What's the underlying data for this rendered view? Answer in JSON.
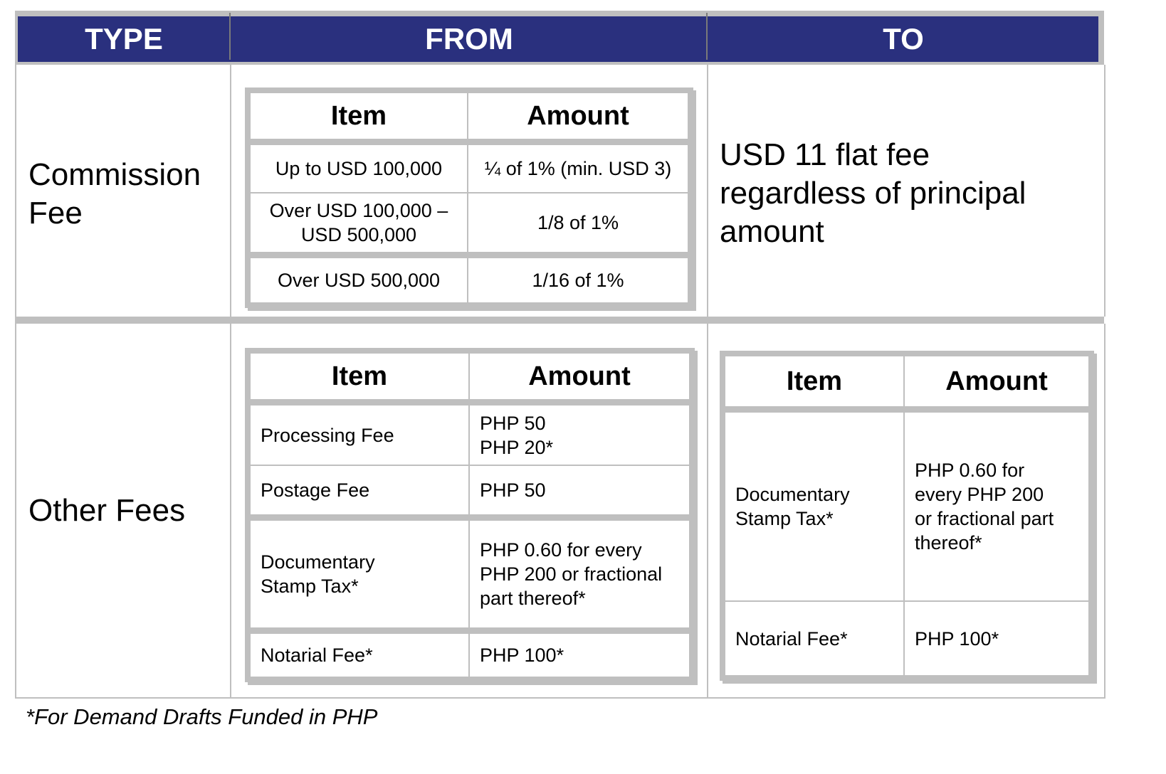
{
  "header": {
    "type": "TYPE",
    "from": "FROM",
    "to": "TO"
  },
  "commission": {
    "type_line1": "Commission",
    "type_line2": "Fee",
    "from_table": {
      "col_item": "Item",
      "col_amount": "Amount",
      "rows": [
        {
          "item": "Up to USD 100,000",
          "amount": "¼ of 1% (min. USD 3)"
        },
        {
          "item_line1": "Over USD 100,000 –",
          "item_line2": "USD 500,000",
          "amount": "1/8 of 1%"
        },
        {
          "item": "Over USD 500,000",
          "amount": "1/16 of 1%"
        }
      ]
    },
    "to_text_line1": "USD 11 flat fee",
    "to_text_line2": "regardless of principal",
    "to_text_line3": "amount"
  },
  "other_fees": {
    "type": "Other Fees",
    "from_table": {
      "col_item": "Item",
      "col_amount": "Amount",
      "rows": [
        {
          "item": "Processing Fee",
          "amount_line1": "PHP 50",
          "amount_line2": "PHP 20*"
        },
        {
          "item": "Postage Fee",
          "amount": "PHP 50"
        },
        {
          "item_line1": "Documentary",
          "item_line2": "Stamp Tax*",
          "amount_line1": "PHP 0.60 for every",
          "amount_line2": "PHP 200 or fractional",
          "amount_line3": "part thereof*"
        },
        {
          "item": "Notarial Fee*",
          "amount": "PHP 100*"
        }
      ]
    },
    "to_table": {
      "col_item": "Item",
      "col_amount": "Amount",
      "rows": [
        {
          "item_line1": "Documentary",
          "item_line2": "Stamp Tax*",
          "amount_line1": "PHP 0.60 for",
          "amount_line2": "every PHP 200",
          "amount_line3": "or fractional part",
          "amount_line4": "thereof*"
        },
        {
          "item": "Notarial Fee*",
          "amount": "PHP 100*"
        }
      ]
    }
  },
  "footnote": "*For Demand Drafts Funded in PHP",
  "colors": {
    "header_bg": "#2a307e",
    "border_gray": "#bfbfbf",
    "header_text": "#ffffff"
  }
}
